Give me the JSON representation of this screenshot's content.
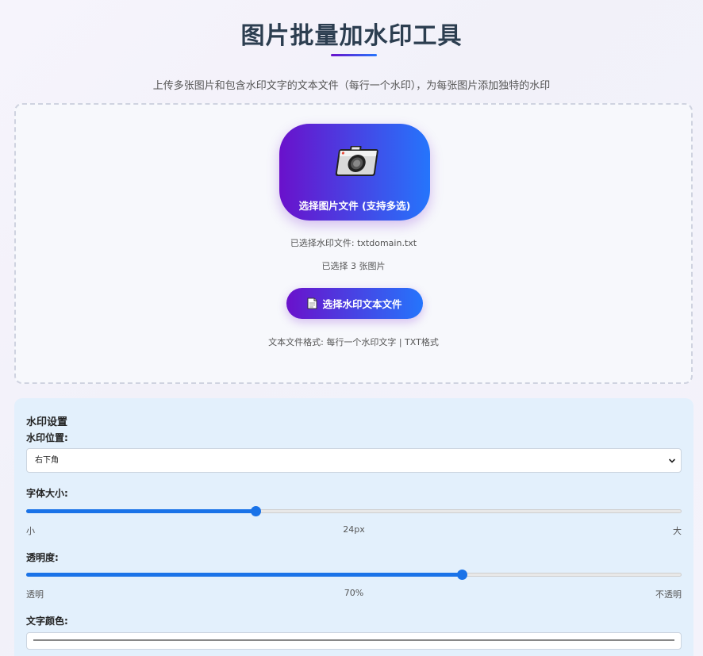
{
  "header": {
    "title": "图片批量加水印工具",
    "subtitle": "上传多张图片和包含水印文字的文本文件（每行一个水印），为每张图片添加独特的水印"
  },
  "upload": {
    "image_button_label": "选择图片文件 (支持多选)",
    "image_button_icon": "camera-icon",
    "selected_watermark_file": "已选择水印文件: txtdomain.txt",
    "selected_images": "已选择 3 张图片",
    "text_button_label": "选择水印文本文件",
    "text_button_icon": "document-icon",
    "format_hint": "文本文件格式: 每行一个水印文字 | TXT格式"
  },
  "settings": {
    "title": "水印设置",
    "position": {
      "label": "水印位置:",
      "selected": "右下角"
    },
    "font_size": {
      "label": "字体大小:",
      "min_label": "小",
      "value_label": "24px",
      "max_label": "大",
      "fraction": 0.35
    },
    "opacity": {
      "label": "透明度:",
      "min_label": "透明",
      "value_label": "70%",
      "max_label": "不透明",
      "fraction": 0.665
    },
    "color": {
      "label": "文字颜色:"
    }
  },
  "colors": {
    "accent_start": "#6a11cb",
    "accent_end": "#2575fc",
    "slider": "#1a73e8"
  }
}
